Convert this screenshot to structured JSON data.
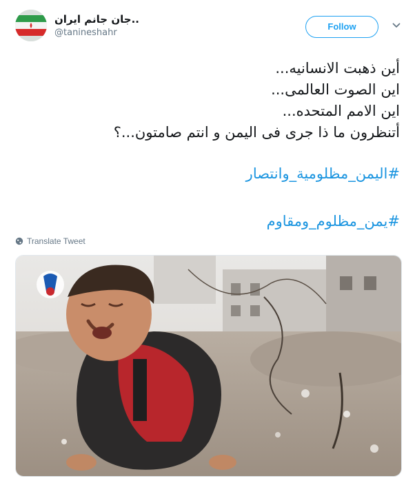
{
  "author": {
    "display_name": "..جان جانم ایران",
    "handle": "@tanineshahr"
  },
  "follow_label": "Follow",
  "tweet": {
    "lines": [
      "أين ذهبت الانسانيه...",
      "اين الصوت العالمى...",
      "اين الامم المتحده...",
      "أتنظرون ما ذا جرى فى اليمن و انتم صامتون...؟"
    ],
    "hashtags": [
      "#اليمن_مظلومية_وانتصار",
      "#يمن_مظلوم_ومقاوم"
    ]
  },
  "translate_label": "Translate Tweet",
  "colors": {
    "accent": "#1da1f2",
    "hashtag": "#1b95e0",
    "muted": "#657786"
  },
  "icons": {
    "caret": "chevron-down-icon",
    "globe": "globe-icon"
  }
}
